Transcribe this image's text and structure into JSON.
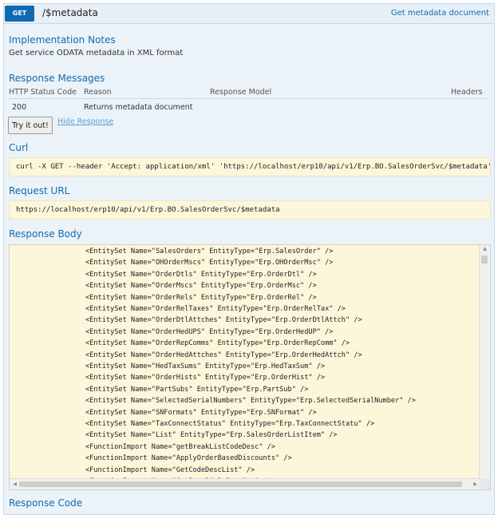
{
  "operation": {
    "method": "GET",
    "path": "/$metadata",
    "doc_link": "Get metadata document"
  },
  "implementation_notes": {
    "heading": "Implementation Notes",
    "text": "Get service ODATA metadata in XML format"
  },
  "response_messages": {
    "heading": "Response Messages",
    "columns": [
      "HTTP Status Code",
      "Reason",
      "Response Model",
      "Headers"
    ],
    "rows": [
      {
        "code": "200",
        "reason": "Returns metadata document"
      }
    ]
  },
  "actions": {
    "try_label": "Try it out!",
    "hide_label": "Hide Response"
  },
  "curl": {
    "heading": "Curl",
    "command": "curl -X GET --header 'Accept: application/xml' 'https://localhost/erp10/api/v1/Erp.BO.SalesOrderSvc/$metadata'"
  },
  "request_url": {
    "heading": "Request URL",
    "url": "https://localhost/erp10/api/v1/Erp.BO.SalesOrderSvc/$metadata"
  },
  "response_body": {
    "heading": "Response Body",
    "lines": [
      "<EntitySet Name=\"SalesOrders\" EntityType=\"Erp.SalesOrder\" />",
      "<EntitySet Name=\"OHOrderMscs\" EntityType=\"Erp.OHOrderMsc\" />",
      "<EntitySet Name=\"OrderDtls\" EntityType=\"Erp.OrderDtl\" />",
      "<EntitySet Name=\"OrderMscs\" EntityType=\"Erp.OrderMsc\" />",
      "<EntitySet Name=\"OrderRels\" EntityType=\"Erp.OrderRel\" />",
      "<EntitySet Name=\"OrderRelTaxes\" EntityType=\"Erp.OrderRelTax\" />",
      "<EntitySet Name=\"OrderDtlAttches\" EntityType=\"Erp.OrderDtlAttch\" />",
      "<EntitySet Name=\"OrderHedUPS\" EntityType=\"Erp.OrderHedUP\" />",
      "<EntitySet Name=\"OrderRepComms\" EntityType=\"Erp.OrderRepComm\" />",
      "<EntitySet Name=\"OrderHedAttches\" EntityType=\"Erp.OrderHedAttch\" />",
      "<EntitySet Name=\"HedTaxSums\" EntityType=\"Erp.HedTaxSum\" />",
      "<EntitySet Name=\"OrderHists\" EntityType=\"Erp.OrderHist\" />",
      "<EntitySet Name=\"PartSubs\" EntityType=\"Erp.PartSub\" />",
      "<EntitySet Name=\"SelectedSerialNumbers\" EntityType=\"Erp.SelectedSerialNumber\" />",
      "<EntitySet Name=\"SNFormats\" EntityType=\"Erp.SNFormat\" />",
      "<EntitySet Name=\"TaxConnectStatus\" EntityType=\"Erp.TaxConnectStatu\" />",
      "<EntitySet Name=\"List\" EntityType=\"Erp.SalesOrderListItem\" />",
      "<FunctionImport Name=\"getBreakListCodeDesc\" />",
      "<FunctionImport Name=\"ApplyOrderBasedDiscounts\" />",
      "<FunctionImport Name=\"GetCodeDescList\" />",
      "<FunctionImport Name=\"GetPartBinByPartNum\" />"
    ]
  },
  "response_code": {
    "heading": "Response Code"
  },
  "colors": {
    "accent": "#0f6ab4",
    "panel_bg": "#ebf3f9",
    "code_bg": "#fcf6db"
  }
}
